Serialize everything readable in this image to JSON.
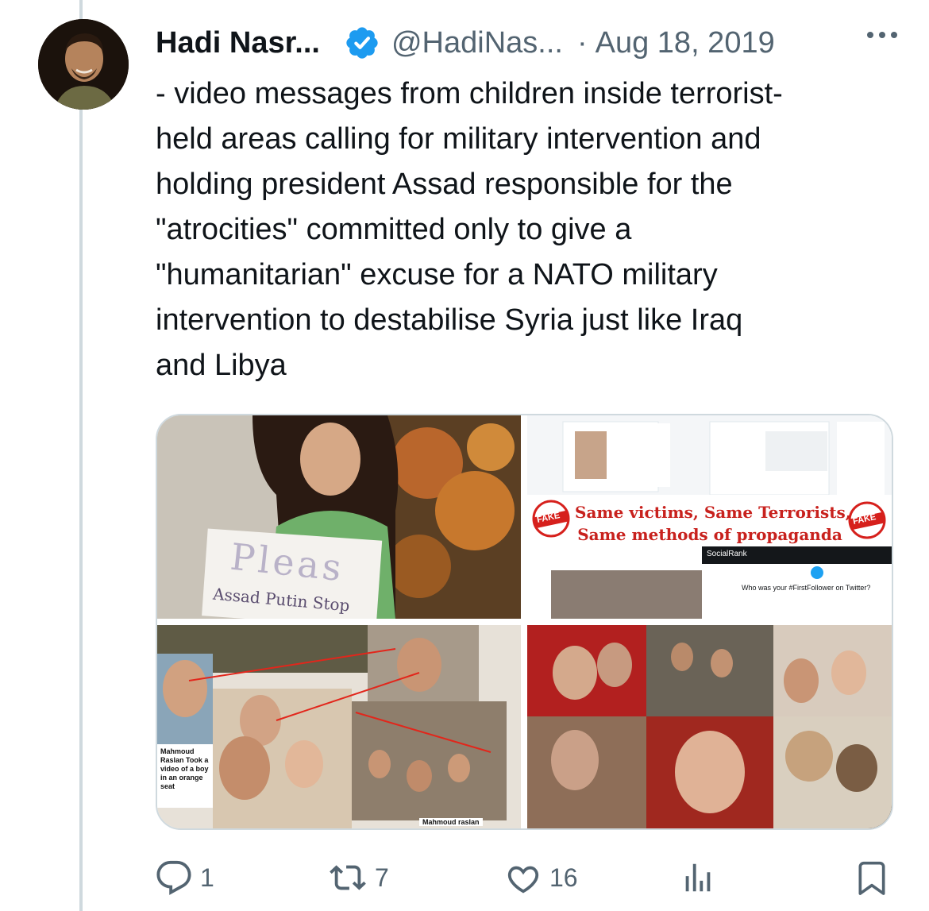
{
  "tweet": {
    "author_name": "Hadi Nasr...",
    "handle": "@HadiNas...",
    "separator": "·",
    "date": "Aug 18, 2019",
    "text": "- video messages from children inside terrorist-\nheld areas calling for military intervention and\nholding president Assad responsible for the\n\"atrocities\" committed only to give a\n\"humanitarian\" excuse for a NATO military\nintervention to destabilise Syria just like Iraq\nand Libya"
  },
  "media": {
    "tile1_sign": "Pleas",
    "tile1_sign_line2": "Assad Putin Stop",
    "tile2_banner_line1": "Same victims, Same Terrorists,",
    "tile2_banner_line2": "Same methods of propaganda",
    "tile2_stamp": "FAKE",
    "tile2_question": "Who was your #FirstFollower on Twitter?",
    "tile2_brand": "SocialRank",
    "tile3_caption_left": "Mahmoud Raslan Took a video of a boy in an orange seat",
    "tile3_caption_bottom": "Mahmoud raslan"
  },
  "actions": {
    "replies": "1",
    "retweets": "7",
    "likes": "16"
  },
  "colors": {
    "verified": "#1d9bf0",
    "muted": "#536471",
    "border": "#cfd9de"
  },
  "icons": [
    "verified-badge-icon",
    "more-icon",
    "reply-icon",
    "retweet-icon",
    "like-icon",
    "views-icon",
    "bookmark-icon"
  ]
}
